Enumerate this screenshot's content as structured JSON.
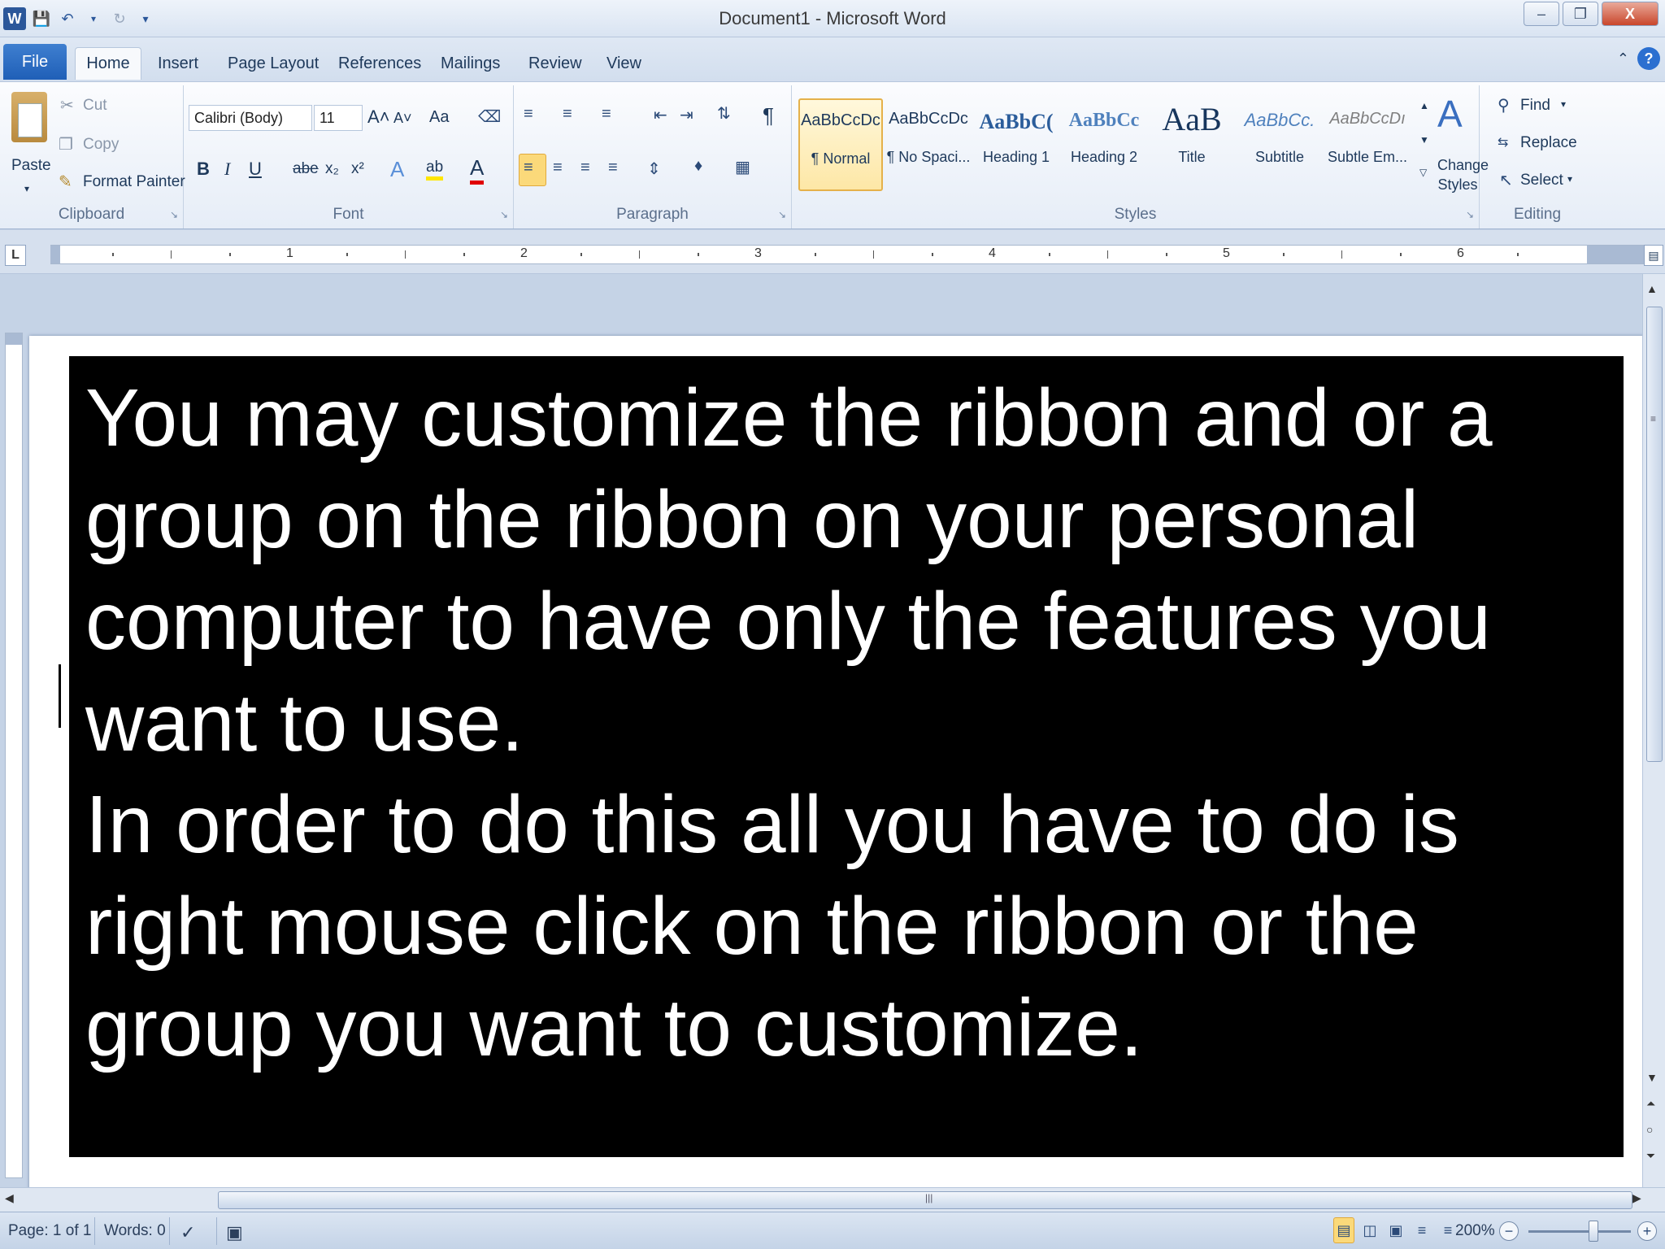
{
  "window": {
    "title": "Document1 - Microsoft Word",
    "minimize": "–",
    "restore": "❐",
    "close": "X"
  },
  "qat": {
    "app_icon": "W",
    "save_icon": "save-icon",
    "undo_icon": "undo-icon",
    "redo_icon": "redo-icon"
  },
  "tabs": {
    "file": "File",
    "home": "Home",
    "insert": "Insert",
    "page_layout": "Page Layout",
    "references": "References",
    "mailings": "Mailings",
    "review": "Review",
    "view": "View"
  },
  "ribbon": {
    "clipboard": {
      "label": "Clipboard",
      "paste": "Paste",
      "cut": "Cut",
      "copy": "Copy",
      "format_painter": "Format Painter"
    },
    "font": {
      "label": "Font",
      "font_name": "Calibri (Body)",
      "font_size": "11",
      "grow": "A˄",
      "shrink": "A˅",
      "change_case": "Aa",
      "bold": "B",
      "italic": "I",
      "underline": "U",
      "strikethrough": "abe",
      "subscript": "x₂",
      "superscript": "x²",
      "text_effects": "A",
      "highlight": "ab",
      "font_color": "A"
    },
    "paragraph": {
      "label": "Paragraph",
      "show_marks": "¶"
    },
    "styles": {
      "label": "Styles",
      "change_styles": "Change Styles",
      "items": [
        {
          "sample": "AaBbCcDc",
          "name": "¶ Normal"
        },
        {
          "sample": "AaBbCcDc",
          "name": "¶ No Spaci..."
        },
        {
          "sample": "AaBbC(",
          "name": "Heading 1"
        },
        {
          "sample": "AaBbCc",
          "name": "Heading 2"
        },
        {
          "sample": "AaB",
          "name": "Title"
        },
        {
          "sample": "AaBbCc.",
          "name": "Subtitle"
        },
        {
          "sample": "AaBbCcDı",
          "name": "Subtle Em..."
        }
      ]
    },
    "editing": {
      "label": "Editing",
      "find": "Find",
      "replace": "Replace",
      "select": "Select"
    }
  },
  "ruler": {
    "tab_selector": "L",
    "numbers": [
      "1",
      "2",
      "3",
      "4",
      "5",
      "6"
    ]
  },
  "document": {
    "paragraph1": "You may customize the ribbon and or a group on the ribbon on your personal computer to have only the features you want to use.",
    "paragraph2": "In order to do this all you have to do is right mouse click on the ribbon or the group you want to customize."
  },
  "status": {
    "page": "Page: 1 of 1",
    "words": "Words: 0",
    "zoom": "200%",
    "zoom_out": "−",
    "zoom_in": "+"
  },
  "colors": {
    "textbox_bg": "#000000",
    "textbox_text": "#ffffff",
    "file_tab": "#2b6fd0",
    "selected_style": "#fde7a6"
  }
}
